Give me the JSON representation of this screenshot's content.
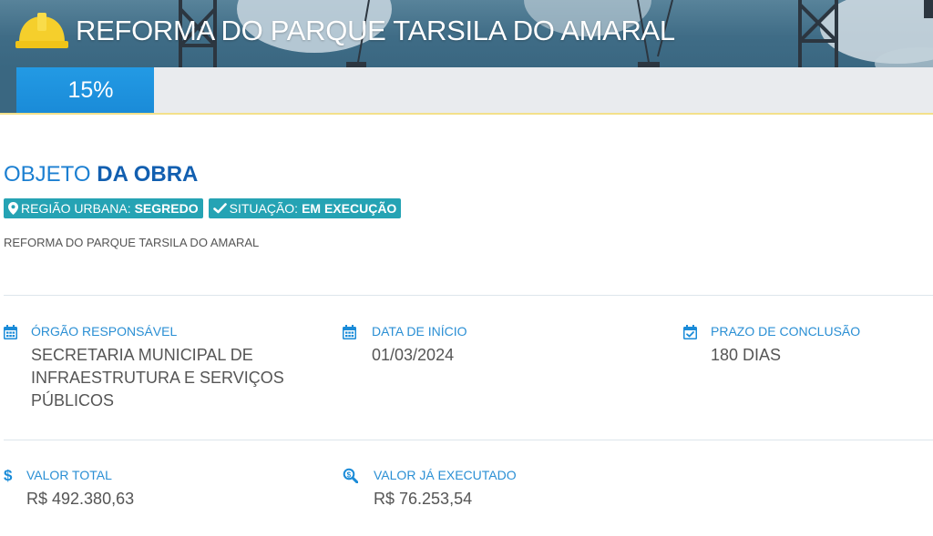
{
  "header": {
    "title": "REFORMA DO PARQUE TARSILA DO AMARAL",
    "icon": "hard-hat-icon"
  },
  "progress": {
    "label": "15%",
    "percent": 15
  },
  "objeto": {
    "heading_light": "OBJETO",
    "heading_bold": "DA OBRA",
    "badges": [
      {
        "icon": "map-marker-icon",
        "label": "REGIÃO URBANA:",
        "value": "SEGREDO"
      },
      {
        "icon": "check-icon",
        "label": "SITUAÇÃO:",
        "value": "EM EXECUÇÃO"
      }
    ],
    "description": "REFORMA DO PARQUE TARSILA DO AMARAL"
  },
  "info": {
    "orgao": {
      "icon": "calendar-icon",
      "label": "ÓRGÃO RESPONSÁVEL",
      "value": "SECRETARIA MUNICIPAL DE INFRAESTRUTURA E SERVIÇOS PÚBLICOS"
    },
    "data_inicio": {
      "icon": "calendar-icon",
      "label": "DATA DE INÍCIO",
      "value": "01/03/2024"
    },
    "prazo": {
      "icon": "calendar-check-icon",
      "label": "PRAZO DE CONCLUSÃO",
      "value": "180 DIAS"
    },
    "valor_total": {
      "icon": "dollar-icon",
      "label": "VALOR TOTAL",
      "value": "R$ 492.380,63"
    },
    "valor_executado": {
      "icon": "search-dollar-icon",
      "label": "VALOR JÁ EXECUTADO",
      "value": "R$ 76.253,54"
    }
  },
  "colors": {
    "accent_blue": "#1a8bd8",
    "heading_blue": "#1b7fd1",
    "badge_teal": "#25a3b4",
    "helmet_yellow": "#f5cf2c"
  }
}
